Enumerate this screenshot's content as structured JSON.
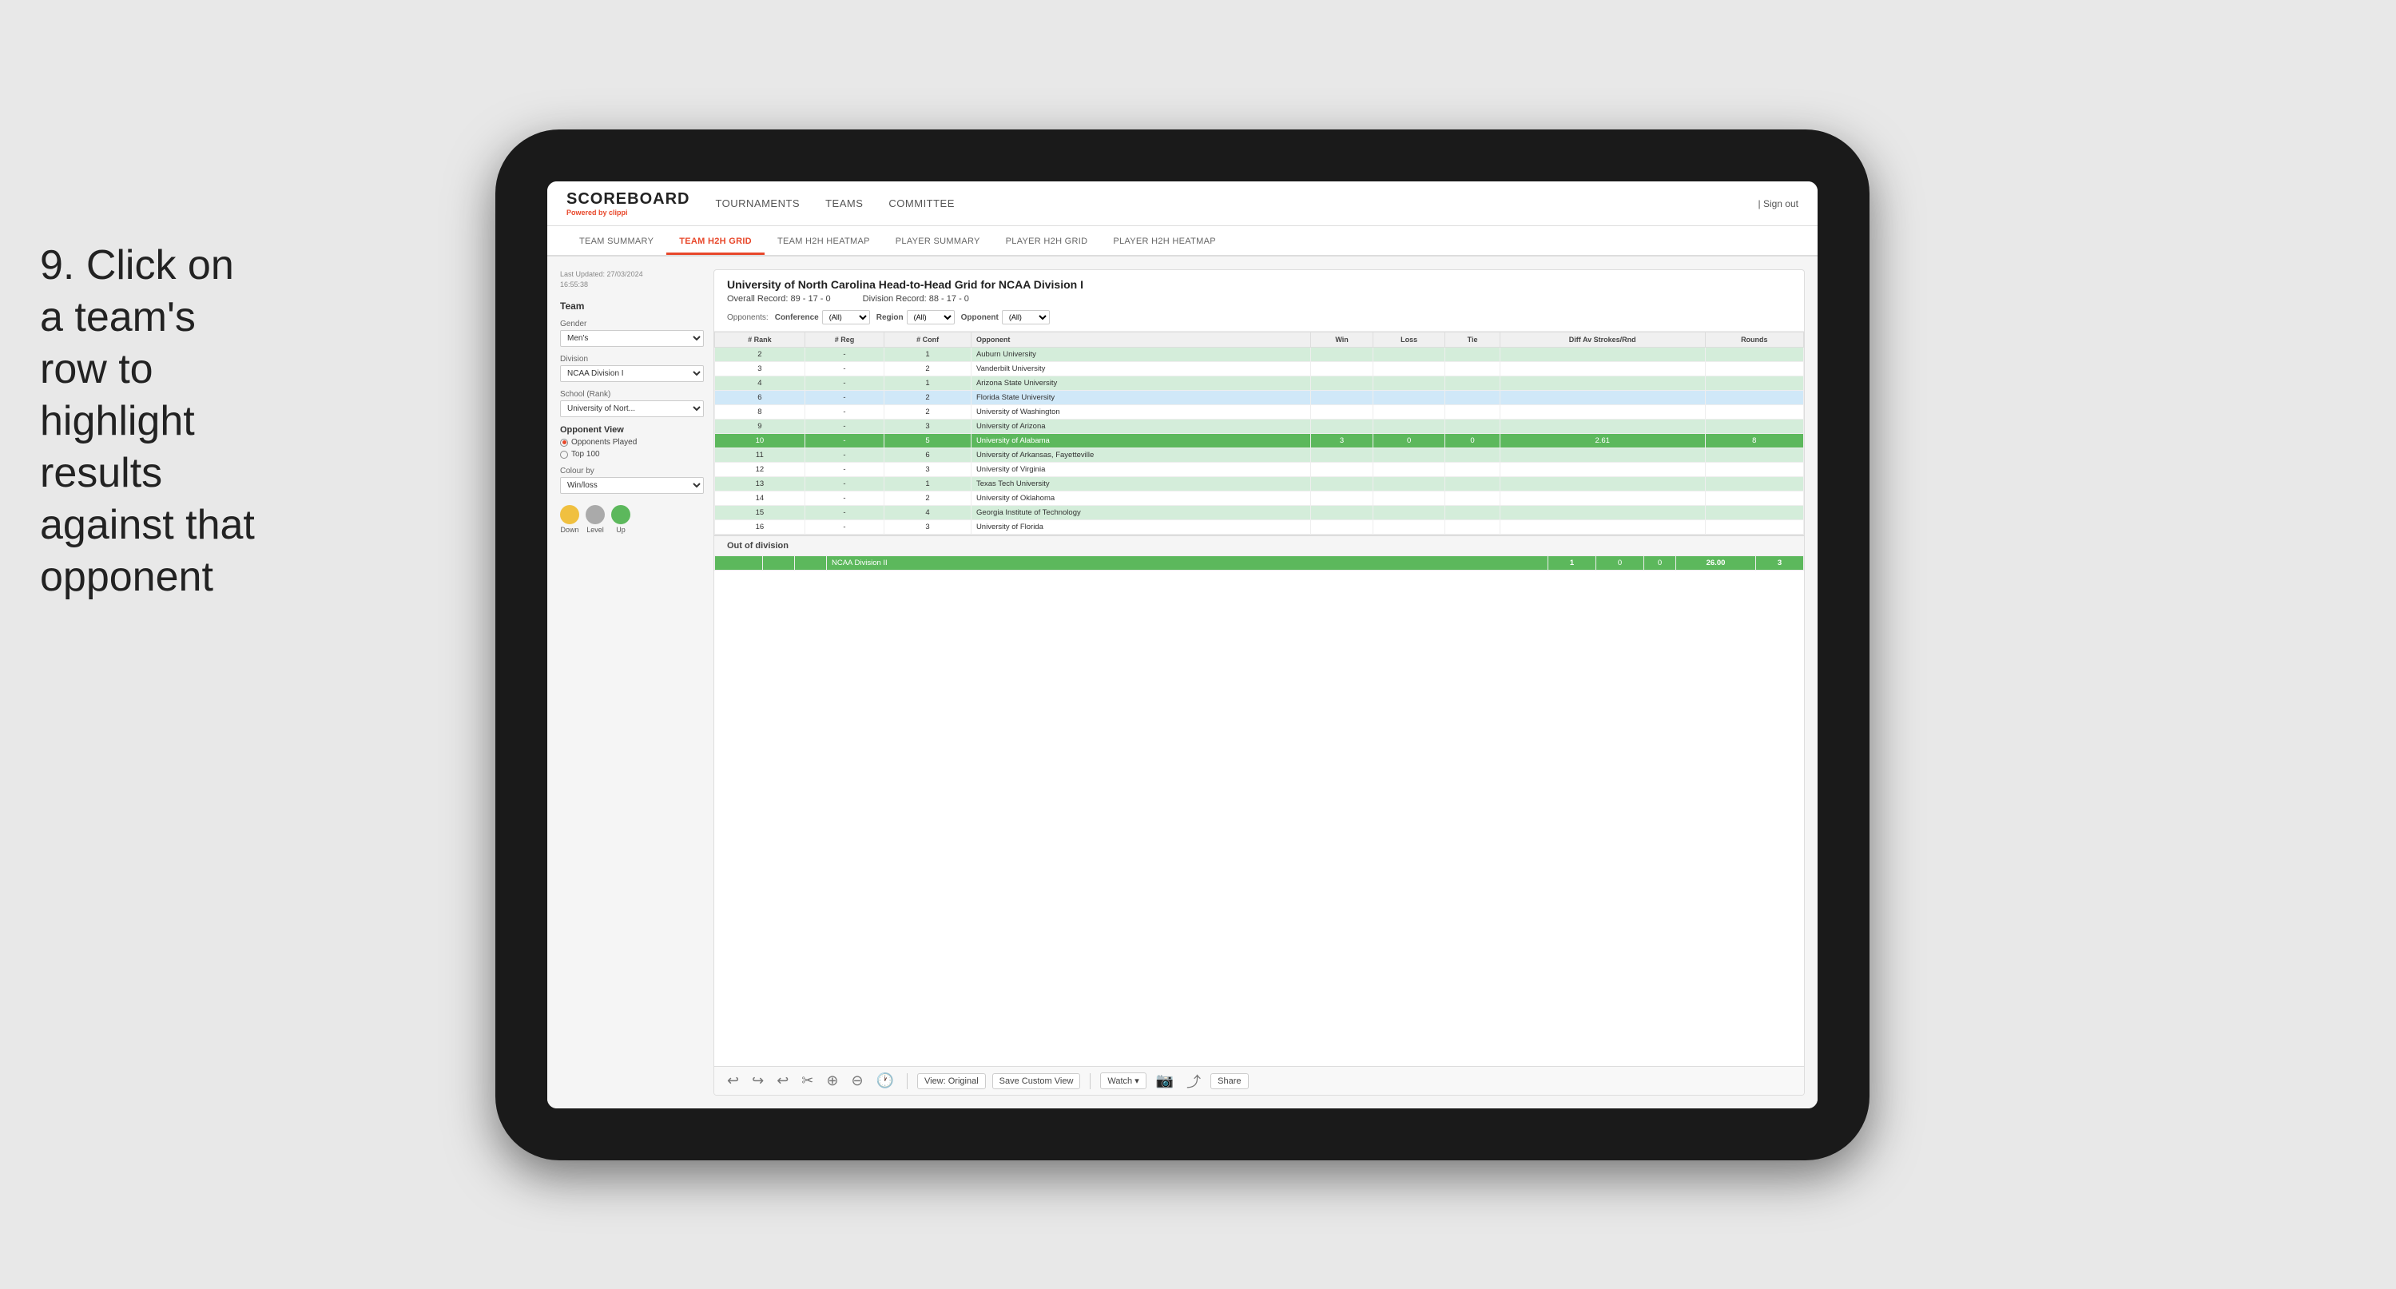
{
  "instruction": {
    "step": "9.",
    "text": "Click on a team's row to highlight results against that opponent"
  },
  "nav": {
    "logo": "SCOREBOARD",
    "logo_sub": "Powered by ",
    "logo_brand": "clippi",
    "links": [
      "TOURNAMENTS",
      "TEAMS",
      "COMMITTEE"
    ],
    "sign_out": "Sign out"
  },
  "sub_tabs": [
    {
      "label": "TEAM SUMMARY",
      "active": false
    },
    {
      "label": "TEAM H2H GRID",
      "active": true
    },
    {
      "label": "TEAM H2H HEATMAP",
      "active": false
    },
    {
      "label": "PLAYER SUMMARY",
      "active": false
    },
    {
      "label": "PLAYER H2H GRID",
      "active": false
    },
    {
      "label": "PLAYER H2H HEATMAP",
      "active": false
    }
  ],
  "left_panel": {
    "last_updated_label": "Last Updated: 27/03/2024",
    "last_updated_time": "16:55:38",
    "team_label": "Team",
    "gender_label": "Gender",
    "gender_value": "Men's",
    "division_label": "Division",
    "division_value": "NCAA Division I",
    "school_label": "School (Rank)",
    "school_value": "University of Nort...",
    "opponent_view_label": "Opponent View",
    "radio_opponents": "Opponents Played",
    "radio_top100": "Top 100",
    "colour_by_label": "Colour by",
    "colour_by_value": "Win/loss",
    "legend_down": "Down",
    "legend_level": "Level",
    "legend_up": "Up",
    "legend_down_color": "#f0c040",
    "legend_level_color": "#aaaaaa",
    "legend_up_color": "#5cb85c"
  },
  "grid": {
    "title": "University of North Carolina Head-to-Head Grid for NCAA Division I",
    "overall_record": "Overall Record: 89 - 17 - 0",
    "division_record": "Division Record: 88 - 17 - 0",
    "filters": {
      "opponents_label": "Opponents:",
      "conference_label": "Conference",
      "conference_value": "(All)",
      "region_label": "Region",
      "region_value": "(All)",
      "opponent_label": "Opponent",
      "opponent_value": "(All)"
    },
    "columns": [
      "# Rank",
      "# Reg",
      "# Conf",
      "Opponent",
      "Win",
      "Loss",
      "Tie",
      "Diff Av Strokes/Rnd",
      "Rounds"
    ],
    "rows": [
      {
        "rank": "2",
        "reg": "-",
        "conf": "1",
        "opponent": "Auburn University",
        "win": "",
        "loss": "",
        "tie": "",
        "diff": "",
        "rounds": "",
        "color": "light-green"
      },
      {
        "rank": "3",
        "reg": "-",
        "conf": "2",
        "opponent": "Vanderbilt University",
        "win": "",
        "loss": "",
        "tie": "",
        "diff": "",
        "rounds": "",
        "color": ""
      },
      {
        "rank": "4",
        "reg": "-",
        "conf": "1",
        "opponent": "Arizona State University",
        "win": "",
        "loss": "",
        "tie": "",
        "diff": "",
        "rounds": "",
        "color": "light-green"
      },
      {
        "rank": "6",
        "reg": "-",
        "conf": "2",
        "opponent": "Florida State University",
        "win": "",
        "loss": "",
        "tie": "",
        "diff": "",
        "rounds": "",
        "color": "light-blue"
      },
      {
        "rank": "8",
        "reg": "-",
        "conf": "2",
        "opponent": "University of Washington",
        "win": "",
        "loss": "",
        "tie": "",
        "diff": "",
        "rounds": "",
        "color": ""
      },
      {
        "rank": "9",
        "reg": "-",
        "conf": "3",
        "opponent": "University of Arizona",
        "win": "",
        "loss": "",
        "tie": "",
        "diff": "",
        "rounds": "",
        "color": "light-green"
      },
      {
        "rank": "10",
        "reg": "-",
        "conf": "5",
        "opponent": "University of Alabama",
        "win": "3",
        "loss": "0",
        "tie": "0",
        "diff": "2.61",
        "rounds": "8",
        "color": "selected-green"
      },
      {
        "rank": "11",
        "reg": "-",
        "conf": "6",
        "opponent": "University of Arkansas, Fayetteville",
        "win": "",
        "loss": "",
        "tie": "",
        "diff": "",
        "rounds": "",
        "color": "light-green"
      },
      {
        "rank": "12",
        "reg": "-",
        "conf": "3",
        "opponent": "University of Virginia",
        "win": "",
        "loss": "",
        "tie": "",
        "diff": "",
        "rounds": "",
        "color": ""
      },
      {
        "rank": "13",
        "reg": "-",
        "conf": "1",
        "opponent": "Texas Tech University",
        "win": "",
        "loss": "",
        "tie": "",
        "diff": "",
        "rounds": "",
        "color": "light-green"
      },
      {
        "rank": "14",
        "reg": "-",
        "conf": "2",
        "opponent": "University of Oklahoma",
        "win": "",
        "loss": "",
        "tie": "",
        "diff": "",
        "rounds": "",
        "color": ""
      },
      {
        "rank": "15",
        "reg": "-",
        "conf": "4",
        "opponent": "Georgia Institute of Technology",
        "win": "",
        "loss": "",
        "tie": "",
        "diff": "",
        "rounds": "",
        "color": "light-green"
      },
      {
        "rank": "16",
        "reg": "-",
        "conf": "3",
        "opponent": "University of Florida",
        "win": "",
        "loss": "",
        "tie": "",
        "diff": "",
        "rounds": "",
        "color": ""
      }
    ],
    "out_of_division_label": "Out of division",
    "out_of_division_row": {
      "division": "NCAA Division II",
      "win": "1",
      "loss": "0",
      "tie": "0",
      "diff": "26.00",
      "rounds": "3"
    }
  },
  "toolbar": {
    "undo": "↩",
    "redo": "↪",
    "view_original": "View: Original",
    "save_custom": "Save Custom View",
    "watch": "Watch ▾",
    "share": "Share"
  }
}
